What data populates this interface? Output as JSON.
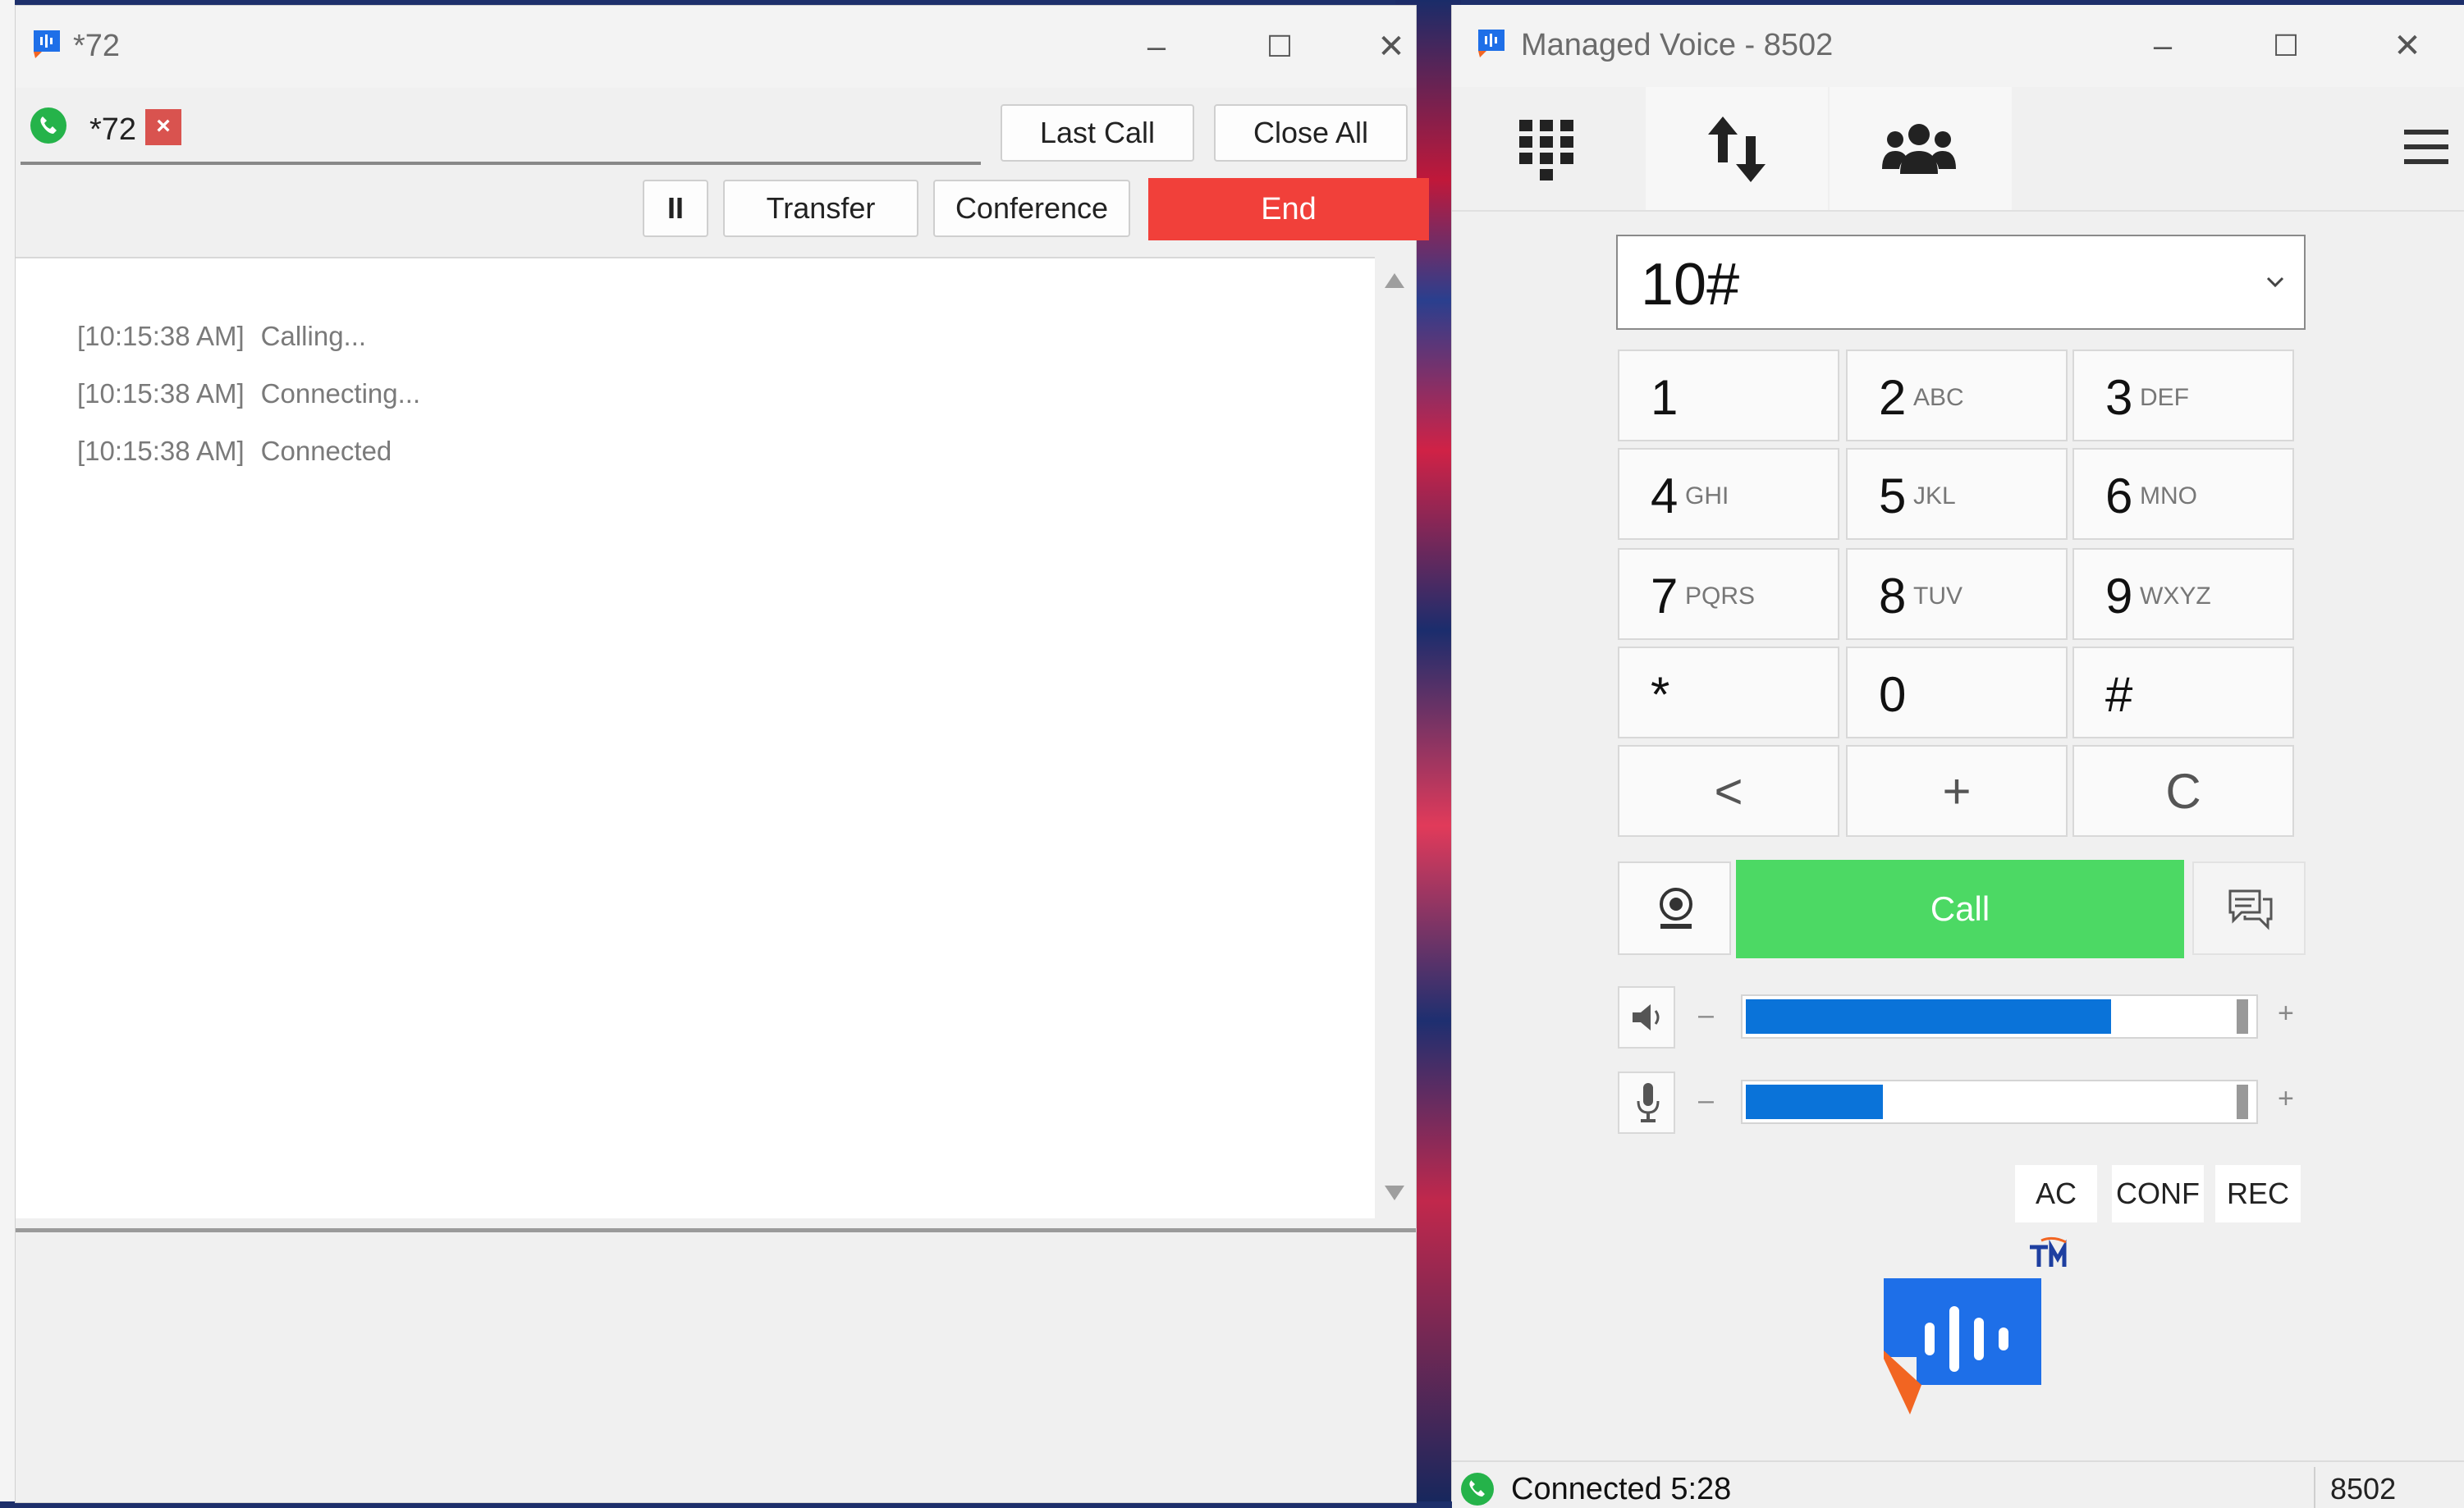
{
  "call_window": {
    "title": "*72",
    "tab": {
      "label": "*72",
      "close_glyph": "×",
      "icon": "phone-connected-icon"
    },
    "buttons": {
      "last_call": "Last Call",
      "close_all": "Close All",
      "pause": "II",
      "transfer": "Transfer",
      "conference": "Conference",
      "end": "End"
    },
    "log": [
      {
        "time": "[10:15:38 AM]",
        "text": "Calling..."
      },
      {
        "time": "[10:15:38 AM]",
        "text": "Connecting..."
      },
      {
        "time": "[10:15:38 AM]",
        "text": "Connected"
      }
    ],
    "controls": {
      "minimize": "–",
      "maximize": "☐",
      "close": "✕"
    }
  },
  "phone_window": {
    "title": "Managed Voice - 8502",
    "controls": {
      "minimize": "–",
      "maximize": "☐",
      "close": "✕"
    },
    "nav": [
      "dialpad-icon",
      "transfer-arrows-icon",
      "contacts-icon",
      "hamburger-menu-icon"
    ],
    "number": "10#",
    "keypad": [
      {
        "digit": "1",
        "letters": ""
      },
      {
        "digit": "2",
        "letters": "ABC"
      },
      {
        "digit": "3",
        "letters": "DEF"
      },
      {
        "digit": "4",
        "letters": "GHI"
      },
      {
        "digit": "5",
        "letters": "JKL"
      },
      {
        "digit": "6",
        "letters": "MNO"
      },
      {
        "digit": "7",
        "letters": "PQRS"
      },
      {
        "digit": "8",
        "letters": "TUV"
      },
      {
        "digit": "9",
        "letters": "WXYZ"
      },
      {
        "digit": "*",
        "letters": ""
      },
      {
        "digit": "0",
        "letters": ""
      },
      {
        "digit": "#",
        "letters": ""
      }
    ],
    "edit_keys": {
      "back": "<",
      "plus": "+",
      "clear": "C"
    },
    "call_label": "Call",
    "speaker": {
      "minus": "–",
      "plus": "+",
      "level": 0.72
    },
    "mic": {
      "minus": "–",
      "plus": "+",
      "level": 0.27
    },
    "feature_buttons": {
      "ac": "AC",
      "conf": "CONF",
      "rec": "REC"
    },
    "status": {
      "text": "Connected 5:28",
      "extension": "8502"
    }
  },
  "colors": {
    "end": "#f1403a",
    "call": "#4cd964",
    "volume": "#0a73d9",
    "logo_blue": "#1e6fe8",
    "logo_orange": "#f26522",
    "status_green": "#25b34a"
  }
}
